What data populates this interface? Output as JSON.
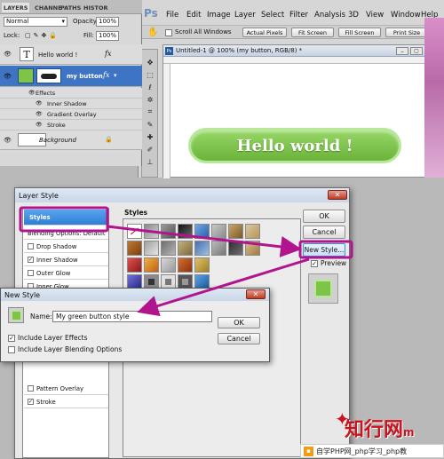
{
  "layers_panel": {
    "tabs": [
      "LAYERS",
      "CHANNE",
      "PATHS",
      "HISTOR"
    ],
    "blend_mode": "Normal",
    "opacity_label": "Opacity:",
    "opacity_value": "100%",
    "lock_label": "Lock:",
    "fill_label": "Fill:",
    "fill_value": "100%",
    "layers": [
      {
        "name": "Hello world !",
        "thumb": "T"
      },
      {
        "name": "my button",
        "fx": "fx"
      },
      {
        "name": "Background"
      }
    ],
    "effects_label": "Effects",
    "effects": [
      "Inner Shadow",
      "Gradient Overlay",
      "Stroke"
    ]
  },
  "photoshop": {
    "logo": "Ps",
    "menu": [
      "File",
      "Edit",
      "Image",
      "Layer",
      "Select",
      "Filter",
      "Analysis",
      "3D",
      "View",
      "Window",
      "Help"
    ],
    "options": {
      "scroll_all_windows": "Scroll All Windows",
      "actual_pixels": "Actual Pixels",
      "fit_screen": "Fit Screen",
      "fill_screen": "Fill Screen",
      "print_size": "Print Size"
    },
    "document_title": "Untitled-1 @ 100% (my button, RGB/8) *",
    "canvas_button_text": "Hello world !"
  },
  "layer_style_dialog": {
    "title": "Layer Style",
    "styles_header": "Styles",
    "list": [
      {
        "label": "Styles",
        "selected": true
      },
      {
        "label": "Blending Options: Default"
      },
      {
        "label": "Drop Shadow",
        "checked": false
      },
      {
        "label": "Inner Shadow",
        "checked": true
      },
      {
        "label": "Outer Glow",
        "checked": false
      },
      {
        "label": "Inner Glow",
        "checked": false
      },
      {
        "label": "Pattern Overlay",
        "checked": false
      },
      {
        "label": "Stroke",
        "checked": true
      }
    ],
    "ok": "OK",
    "cancel": "Cancel",
    "new_style": "New Style...",
    "preview_label": "Preview",
    "preview_checked": true
  },
  "new_style_dialog": {
    "title": "New Style",
    "name_label": "Name:",
    "name_value": "My green button style",
    "ok": "OK",
    "cancel": "Cancel",
    "include_effects": "Include Layer Effects",
    "include_effects_checked": true,
    "include_blending": "Include Layer Blending Options",
    "include_blending_checked": false
  },
  "watermark": {
    "logo_text": "知行网",
    "logo_suffix": "m",
    "caption": "自学PHP网_php学习_php教"
  },
  "colors": {
    "highlight_magenta": "#b0148e",
    "button_green": "#7dc447",
    "selection_blue": "#3b8edb"
  }
}
